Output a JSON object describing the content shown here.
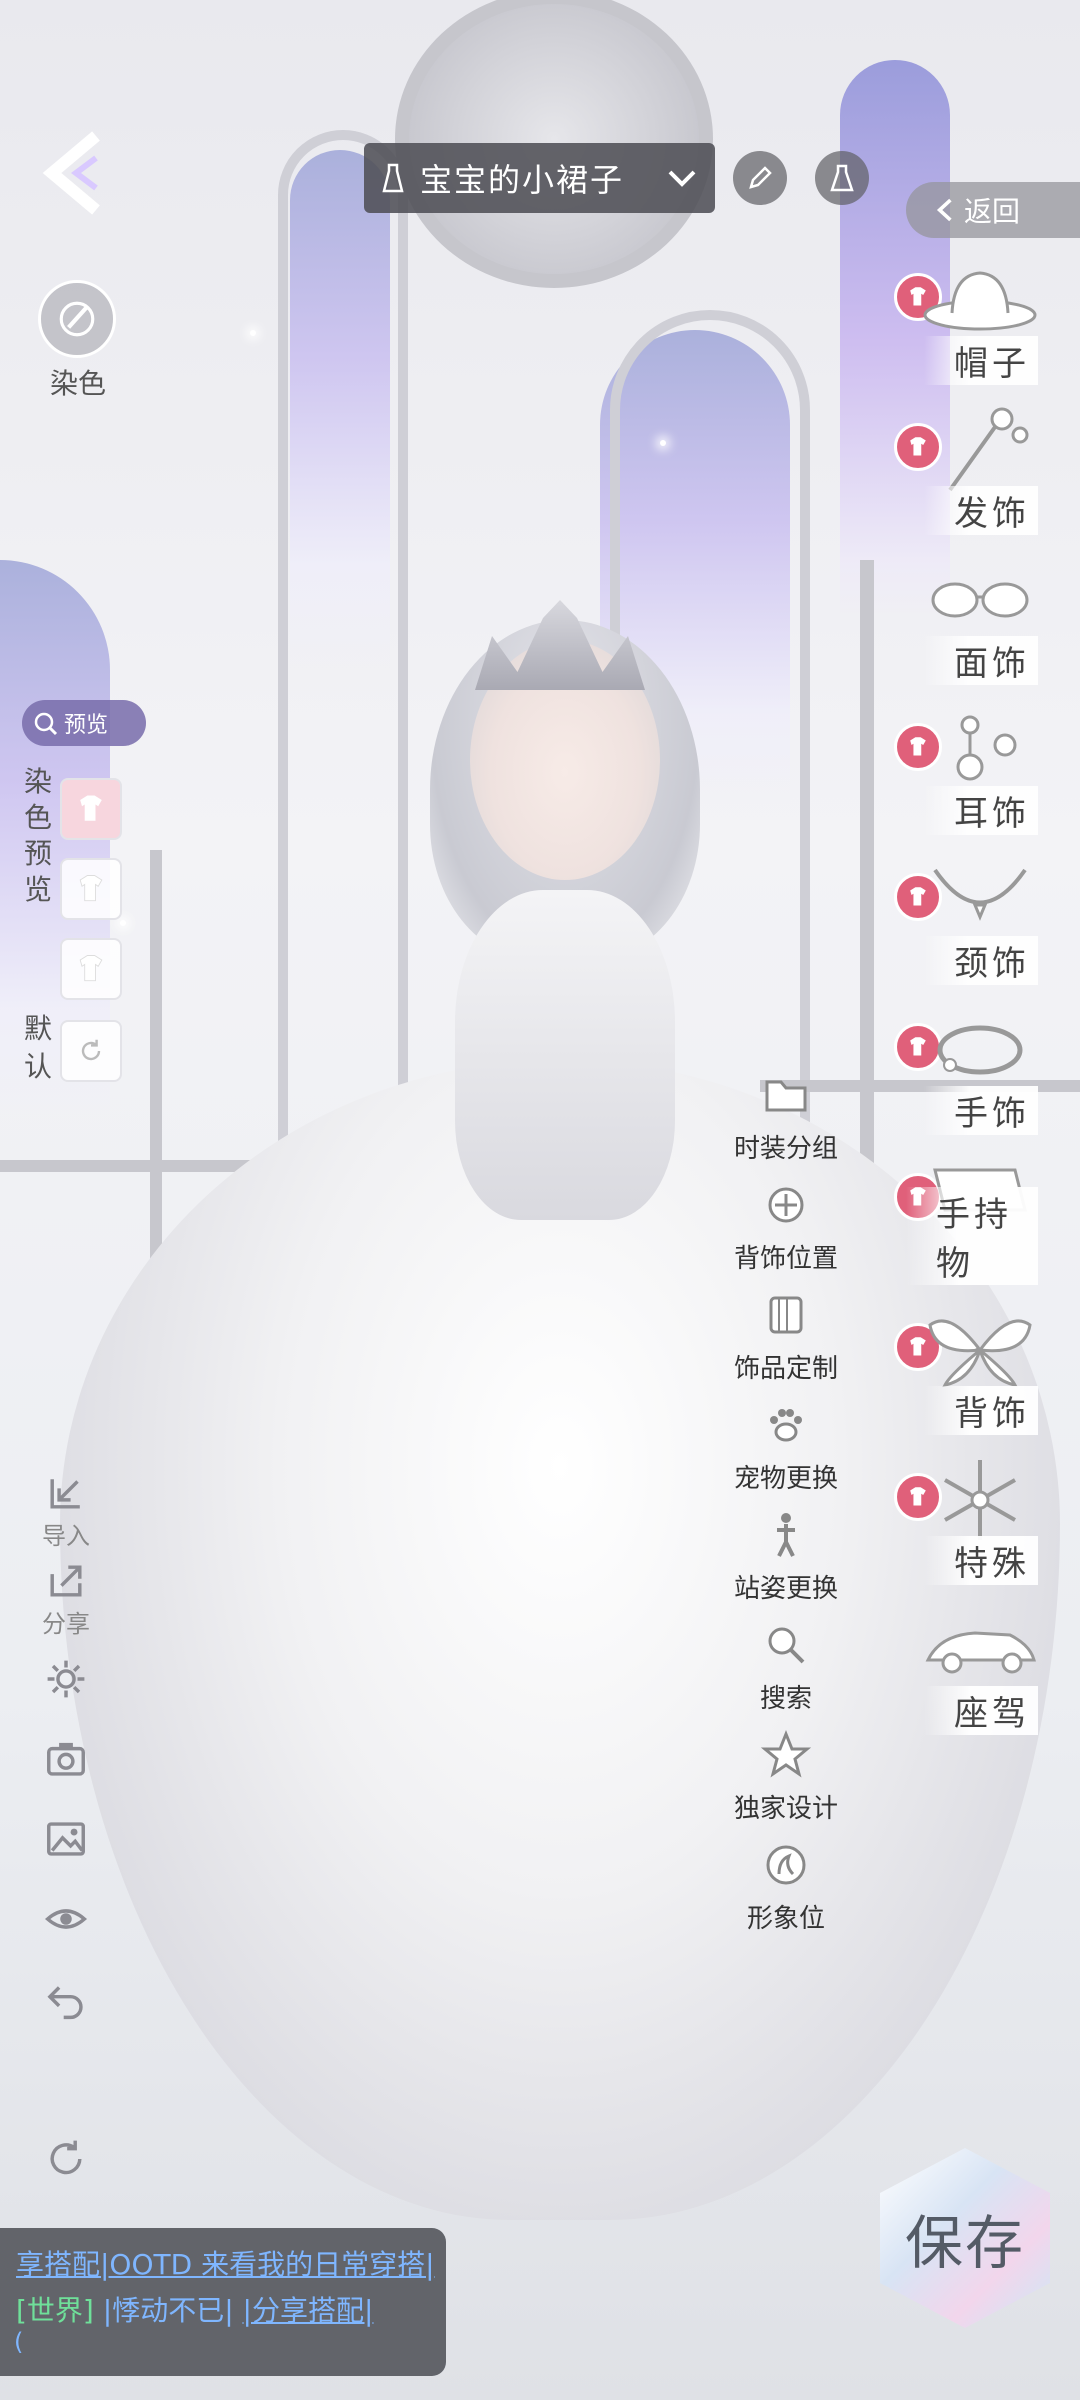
{
  "header": {
    "back_icon": "chevron-left-icon",
    "outfit_name": "宝宝的小裙子",
    "edit_icon": "pen-icon",
    "wardrobe_icon": "dress-icon",
    "return_label": "返回"
  },
  "left_panel": {
    "dye_label": "染色",
    "preview_label": "预览",
    "dye_preview_label": "染色预览",
    "default_label": "默认",
    "tools": [
      {
        "label": "导入",
        "icon": "import-icon"
      },
      {
        "label": "分享",
        "icon": "share-icon"
      },
      {
        "label": "",
        "icon": "gear-icon"
      },
      {
        "label": "",
        "icon": "camera-icon"
      },
      {
        "label": "",
        "icon": "image-icon"
      },
      {
        "label": "",
        "icon": "eye-icon"
      },
      {
        "label": "",
        "icon": "undo-icon"
      },
      {
        "label": "",
        "icon": "reset-icon"
      }
    ]
  },
  "categories": [
    {
      "label": "帽子",
      "icon": "hat-icon"
    },
    {
      "label": "发饰",
      "icon": "hairpin-icon"
    },
    {
      "label": "面饰",
      "icon": "glasses-icon"
    },
    {
      "label": "耳饰",
      "icon": "earring-icon"
    },
    {
      "label": "颈饰",
      "icon": "necklace-icon"
    },
    {
      "label": "手饰",
      "icon": "bracelet-icon"
    },
    {
      "label": "手持物",
      "icon": "handheld-icon"
    },
    {
      "label": "背饰",
      "icon": "wings-icon"
    },
    {
      "label": "特殊",
      "icon": "snowflake-icon"
    },
    {
      "label": "座驾",
      "icon": "car-icon"
    }
  ],
  "mid_menu": [
    {
      "label": "时装分组",
      "icon": "folder-icon"
    },
    {
      "label": "背饰位置",
      "icon": "position-icon"
    },
    {
      "label": "饰品定制",
      "icon": "customize-icon"
    },
    {
      "label": "宠物更换",
      "icon": "paw-icon"
    },
    {
      "label": "站姿更换",
      "icon": "pose-icon"
    },
    {
      "label": "搜索",
      "icon": "search-icon"
    },
    {
      "label": "独家设计",
      "icon": "star-icon"
    },
    {
      "label": "形象位",
      "icon": "profile-icon"
    }
  ],
  "chat": {
    "line1": "享搭配|OOTD 来看我的日常穿搭|",
    "channel": "[世界]",
    "user": "|悸动不已|",
    "message": "|分享搭配|",
    "line3": "("
  },
  "save_label": "保存",
  "colors": {
    "badge": "#e0607a",
    "panel_dark": "#505056",
    "chat_blue": "#7fb6ff",
    "chat_green": "#6fe09a"
  }
}
